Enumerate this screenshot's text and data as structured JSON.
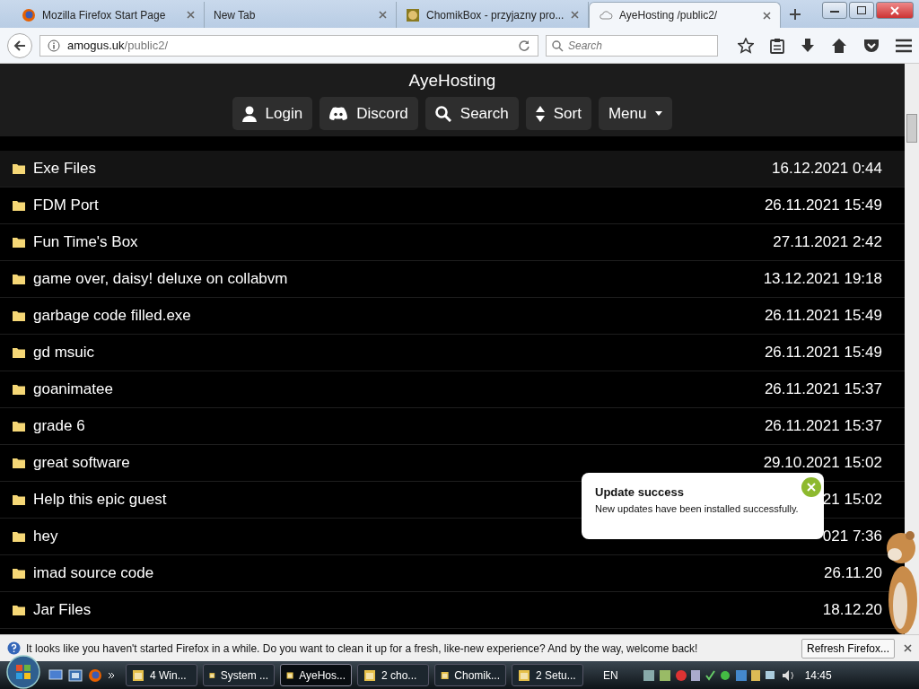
{
  "browser": {
    "tabs": [
      {
        "title": "Mozilla Firefox Start Page",
        "selected": false
      },
      {
        "title": "New Tab",
        "selected": false
      },
      {
        "title": "ChomikBox - przyjazny pro...",
        "selected": false
      },
      {
        "title": "AyeHosting /public2/",
        "selected": true
      }
    ],
    "url_host": "amogus.uk",
    "url_path": "/public2/",
    "search_placeholder": "Search"
  },
  "site": {
    "title": "AyeHosting",
    "nav": [
      {
        "label": "Login"
      },
      {
        "label": "Discord"
      },
      {
        "label": "Search"
      },
      {
        "label": "Sort"
      },
      {
        "label": "Menu"
      }
    ]
  },
  "folders": [
    {
      "name": "Exe Files",
      "date": "16.12.2021 0:44",
      "hovered": true
    },
    {
      "name": "FDM Port",
      "date": "26.11.2021 15:49",
      "hovered": false
    },
    {
      "name": "Fun Time's Box",
      "date": "27.11.2021 2:42",
      "hovered": false
    },
    {
      "name": "game over, daisy! deluxe on collabvm",
      "date": "13.12.2021 19:18",
      "hovered": false
    },
    {
      "name": "garbage code filled.exe",
      "date": "26.11.2021 15:49",
      "hovered": false
    },
    {
      "name": "gd msuic",
      "date": "26.11.2021 15:49",
      "hovered": false
    },
    {
      "name": "goanimatee",
      "date": "26.11.2021 15:37",
      "hovered": false
    },
    {
      "name": "grade 6",
      "date": "26.11.2021 15:37",
      "hovered": false
    },
    {
      "name": "great software",
      "date": "29.10.2021 15:02",
      "hovered": false
    },
    {
      "name": "Help this epic guest",
      "date": "21 15:02",
      "hovered": false
    },
    {
      "name": "hey",
      "date": "021 7:36",
      "hovered": false
    },
    {
      "name": "imad source code",
      "date": "26.11.20",
      "hovered": false
    },
    {
      "name": "Jar Files",
      "date": "18.12.20",
      "hovered": false
    }
  ],
  "popup": {
    "title": "Update success",
    "message": "New updates have been installed successfully."
  },
  "notification": {
    "message": "It looks like you haven't started Firefox in a while. Do you want to clean it up for a fresh, like-new experience? And by the way, welcome back!",
    "button": "Refresh Firefox..."
  },
  "taskbar": {
    "items": [
      {
        "label": "4 Win...",
        "selected": false
      },
      {
        "label": "System ...",
        "selected": false
      },
      {
        "label": "AyeHos...",
        "selected": true
      },
      {
        "label": "2 cho...",
        "selected": false
      },
      {
        "label": "Chomik...",
        "selected": false
      },
      {
        "label": "2 Setu...",
        "selected": false
      }
    ],
    "language": "EN",
    "time": "14:45"
  }
}
